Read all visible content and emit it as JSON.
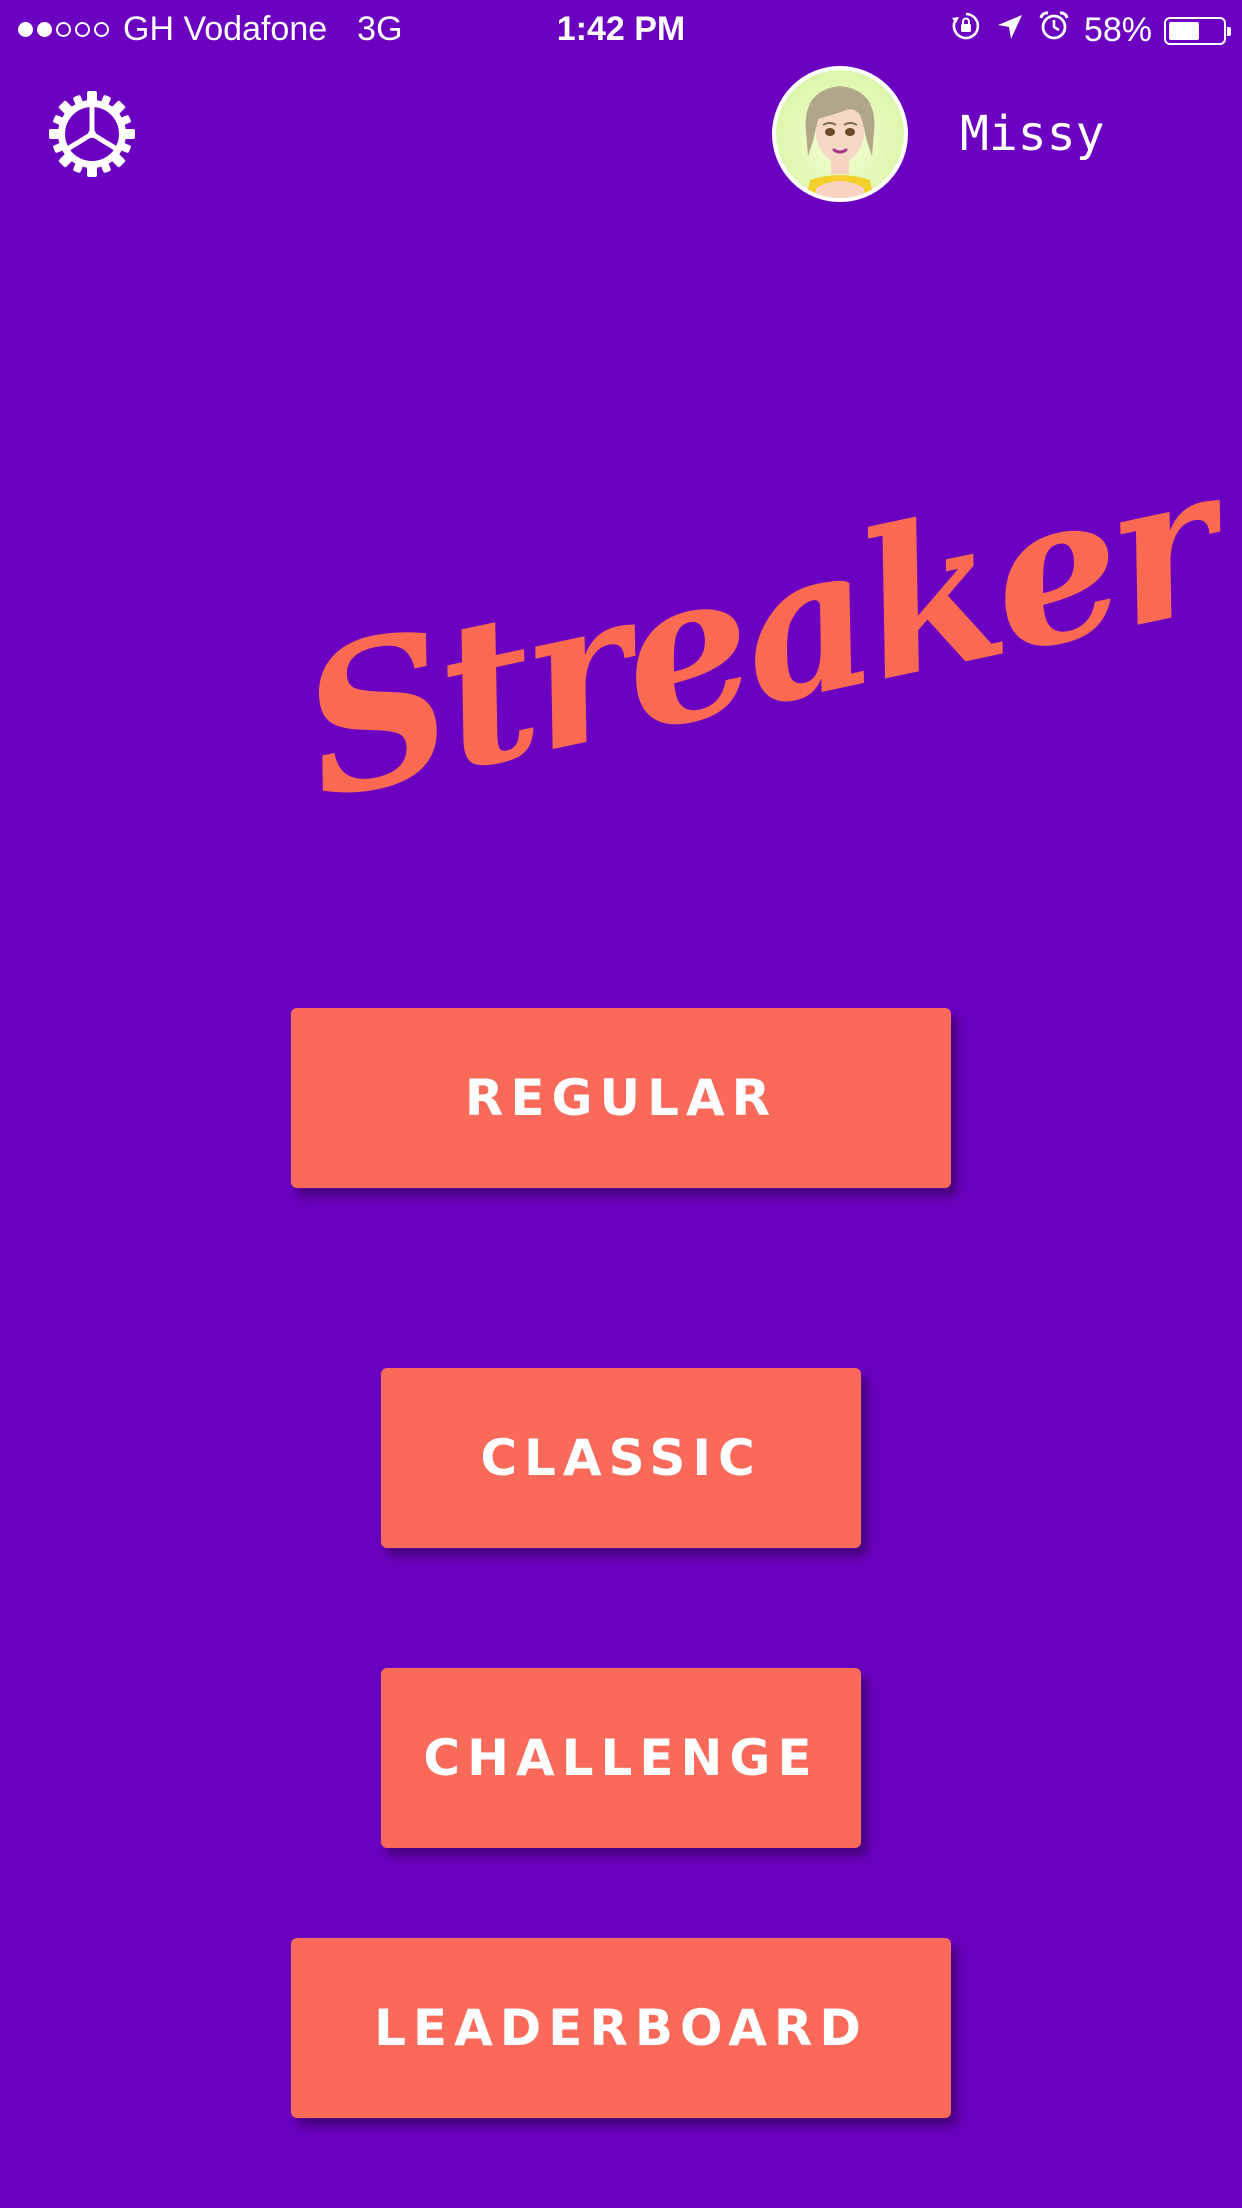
{
  "status_bar": {
    "carrier": "GH Vodafone",
    "network": "3G",
    "time": "1:42 PM",
    "battery_percent": "58%",
    "battery_level": 0.58,
    "signal_bars_filled": 2,
    "signal_bars_total": 5,
    "icons": [
      "orientation-lock-icon",
      "location-arrow-icon",
      "alarm-icon",
      "battery-icon"
    ]
  },
  "header": {
    "settings_icon": "gear-icon",
    "username": "Missy"
  },
  "logo": {
    "text": "Streaker"
  },
  "menu": {
    "regular_label": "REGULAR",
    "classic_label": "CLASSIC",
    "challenge_label": "CHALLENGE",
    "leaderboard_label": "LEADERBOARD"
  },
  "colors": {
    "background": "#6b00c0",
    "accent": "#fa6a5a",
    "text": "#ffffff"
  }
}
